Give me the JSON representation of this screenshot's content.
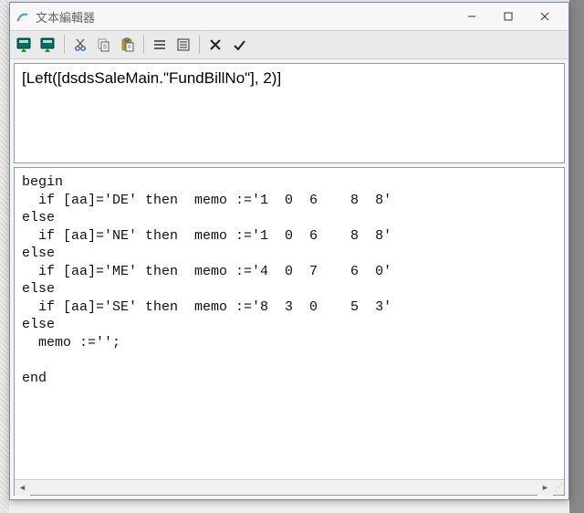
{
  "window": {
    "title": "文本編輯器"
  },
  "toolbar": {
    "icons": {
      "insert_expr": "insert-expression-icon",
      "insert_aggregate": "insert-aggregate-icon",
      "cut": "cut-icon",
      "copy": "copy-icon",
      "paste": "paste-icon",
      "word_wrap": "word-wrap-icon",
      "format": "format-icon",
      "cancel": "cancel-icon",
      "ok": "ok-icon"
    }
  },
  "expression": {
    "text": "[Left([dsdsSaleMain.\"FundBillNo\"], 2)]"
  },
  "script": {
    "text": "begin\n  if [aa]='DE' then  memo :='1  0  6    8  8'\nelse\n  if [aa]='NE' then  memo :='1  0  6    8  8'\nelse\n  if [aa]='ME' then  memo :='4  0  7    6  0'\nelse\n  if [aa]='SE' then  memo :='8  3  0    5  3'\nelse\n  memo :='';\n\nend"
  }
}
